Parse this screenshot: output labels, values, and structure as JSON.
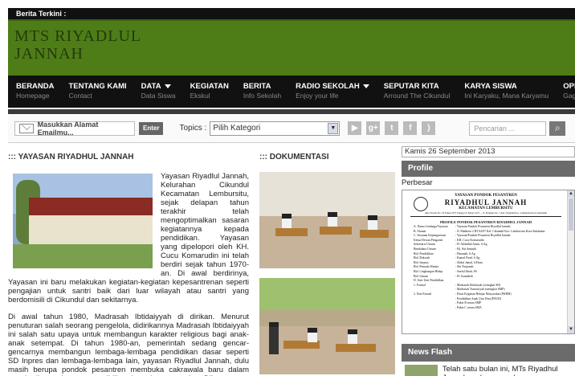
{
  "topbar": {
    "label": "Berita Terkini :"
  },
  "site": {
    "title": "MTS RIYADLUL\nJANNAH"
  },
  "nav": [
    {
      "title": "BERANDA",
      "sub": "Homepage",
      "dropdown": false
    },
    {
      "title": "TENTANG KAMI",
      "sub": "Contact",
      "dropdown": false
    },
    {
      "title": "DATA",
      "sub": "Data Siswa",
      "dropdown": true
    },
    {
      "title": "KEGIATAN",
      "sub": "Ekskul",
      "dropdown": false
    },
    {
      "title": "BERITA",
      "sub": "Info Sekolah",
      "dropdown": false
    },
    {
      "title": "RADIO SEKOLAH",
      "sub": "Enjoy your life",
      "dropdown": true
    },
    {
      "title": "SEPUTAR KITA",
      "sub": "Arround The Cikundul",
      "dropdown": false
    },
    {
      "title": "KARYA SISWA",
      "sub": "Ini Karyaku, Mana Karyamu",
      "dropdown": false
    },
    {
      "title": "OPINI",
      "sub": "Gagasan Anda",
      "dropdown": false
    }
  ],
  "toolbar": {
    "email_placeholder": "Masukkan Alamat Emailmu...",
    "enter_label": "Enter",
    "topics_label": "Topics :",
    "category_value": "Pilih Kategori",
    "social_icons": [
      "youtube-icon",
      "google-plus-icon",
      "twitter-icon",
      "facebook-icon",
      "rss-icon"
    ],
    "search_placeholder": "Pencarian ..."
  },
  "main": {
    "heading": "::: YAYASAN RIYADHUL JANNAH",
    "p1": "Yayasan Riyadlul Jannah, Kelurahan Cikundul Kecamatan Lembursitu, sejak delapan tahun terakhir telah mengoptimalkan sasaran kegiatannya kepada pendidikan. Yayasan yang dipelopori oleh KH. Cucu Komarudin ini telah berdiri sejak tahun 1970-an. Di awal berdirinya, Yayasan ini baru melakukan kegiatan-kegiatan kepesantrenan seperti pengajian untuk santri baik dari luar wilayah atau santri yang berdomisili di Cikundul dan sekitarnya.",
    "p2": "Di awal tahun 1980, Madrasah Ibtidaiyyah di dirikan. Menurut penuturan salah seorang pengelola, didirikannya Madrasah Ibtidaiyyah ini salah satu upaya untuk membangun karakter religious bagi anak-anak setempat. Di tahun 1980-an, pemerintah sedang gencar-gencarnya membangun lembaga-lembaga pendidikan dasar seperti SD Inpres dan lembaga-lembaga lain, yayasan Riyadlul Jannah, dulu masih berupa pondok pesantren membuka cakrawala baru dalam memberikan pelayanan pendidikan kepada masyarakat. Dibangunnya MI merupakan sejarah baru"
  },
  "docs": {
    "heading": "::: DOKUMENTASI"
  },
  "sidebar": {
    "date": "Kamis 26 September 2013",
    "profile_title": "Profile",
    "profile_sub": "Perbesar",
    "doc": {
      "h1": "YAYASAN PONDOK PESANTREN",
      "h2": "RIYADHUL JANNAH",
      "h3": "KECAMATAN LEMBURSITU",
      "addr": "Akte Notaris No. 33 Tahun 1973 Tanggal 27 Maret 1973 — Jl. Pramuka No. 1 Kel. Cikundul Kec. Lembursitu Kota Sukabumi",
      "title": "PROFILE PONDOK PESANTREN RIYADHUL JANNAH",
      "rows": [
        [
          "A. Nama Lembaga/Yayasan",
          ": Yayasan Pondok Pesantren Riyadlul Jannah"
        ],
        [
          "B. Alamat",
          ": Jl. Mahkota 2 RT 04/07 Kel. Cikundul Kec. Lembursitu Kota Sukabumi"
        ],
        [
          "C. Susunan Kepengurusan",
          ": Yayasan/Pondok Pesantren Riyadlul Jannah"
        ],
        [
          "Ketua Dewan Pengasuh",
          ": KH. Cucu Komarudin"
        ],
        [
          "Sekretaris Umum",
          ": H. Abdullah Amin, S.Ag"
        ],
        [
          "Bendahara Umum",
          ": Hj. Siti Aminah"
        ],
        [
          "Bid. Pendidikan",
          ": Hasanah, S.Ag"
        ],
        [
          "Bid. Dakwah",
          ": Kamal Fuad, S.Ag"
        ],
        [
          "Bid. Sarpras",
          ": Abdul Jamal, S.Hum"
        ],
        [
          "Bid. Pemuda Wanita",
          ": Siti Nurjanah"
        ],
        [
          "Bid. Lingkungan Hidup",
          ": Saeful Jihad, SS"
        ],
        [
          "Bid. Umum",
          ": H. Asmadiah"
        ],
        [
          "D. Unit-Unit Pendidikan",
          ""
        ],
        [
          "1. Formal",
          ": Madrasah Ibtidaiyah (setingkat SD)"
        ],
        [
          "",
          ": Madrasah Tsanawiyah (setingkat SMP)"
        ],
        [
          "2. Non Formal",
          ": Pusat Kegiatan Belajar Masyarakat (PKBM)"
        ],
        [
          "",
          ": Pendidikan Anak Usia Dini (PAUD)"
        ],
        [
          "",
          ": Paket B setara SMP"
        ],
        [
          "",
          ": Paket C setara SMA"
        ]
      ]
    },
    "news_title": "News Flash",
    "news_text": "Telah satu bulan ini, MTs Riyadhul Jannah sedang membangun"
  }
}
